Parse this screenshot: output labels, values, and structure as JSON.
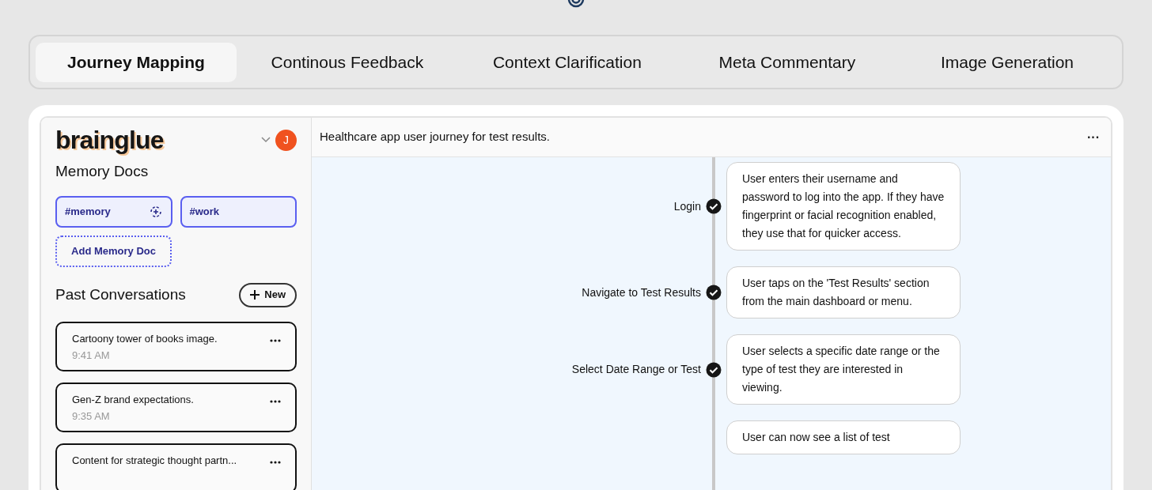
{
  "tabs": [
    {
      "label": "Journey Mapping",
      "selected": true
    },
    {
      "label": "Continous Feedback",
      "selected": false
    },
    {
      "label": "Context Clarification",
      "selected": false
    },
    {
      "label": "Meta Commentary",
      "selected": false
    },
    {
      "label": "Image Generation",
      "selected": false
    }
  ],
  "sidebar": {
    "logo": "brainglue",
    "avatar": "J",
    "memory_title": "Memory Docs",
    "memory_docs": [
      {
        "label": "#memory",
        "syncing": true
      },
      {
        "label": "#work",
        "syncing": false
      }
    ],
    "add_memory": "Add Memory Doc",
    "past_title": "Past Conversations",
    "new_button": "New",
    "conversations": [
      {
        "title": "Cartoony tower of books image.",
        "time": "9:41 AM"
      },
      {
        "title": "Gen-Z brand expectations.",
        "time": "9:35 AM"
      },
      {
        "title": "Content for strategic thought partn..."
      }
    ]
  },
  "main": {
    "title": "Healthcare app user journey for test results.",
    "menu": "···",
    "steps": [
      {
        "label": "Login",
        "done": true,
        "text": "User enters their username and password to log into the app. If they have fingerprint or facial recognition enabled, they use that for quicker access."
      },
      {
        "label": "Navigate to Test Results",
        "done": true,
        "text": "User taps on the 'Test Results' section from the main dashboard or menu."
      },
      {
        "label": "Select Date Range or Test",
        "done": true,
        "text": "User selects a specific date range or the type of test they are interested in viewing."
      },
      {
        "text": "User can now see a list of test"
      }
    ]
  }
}
